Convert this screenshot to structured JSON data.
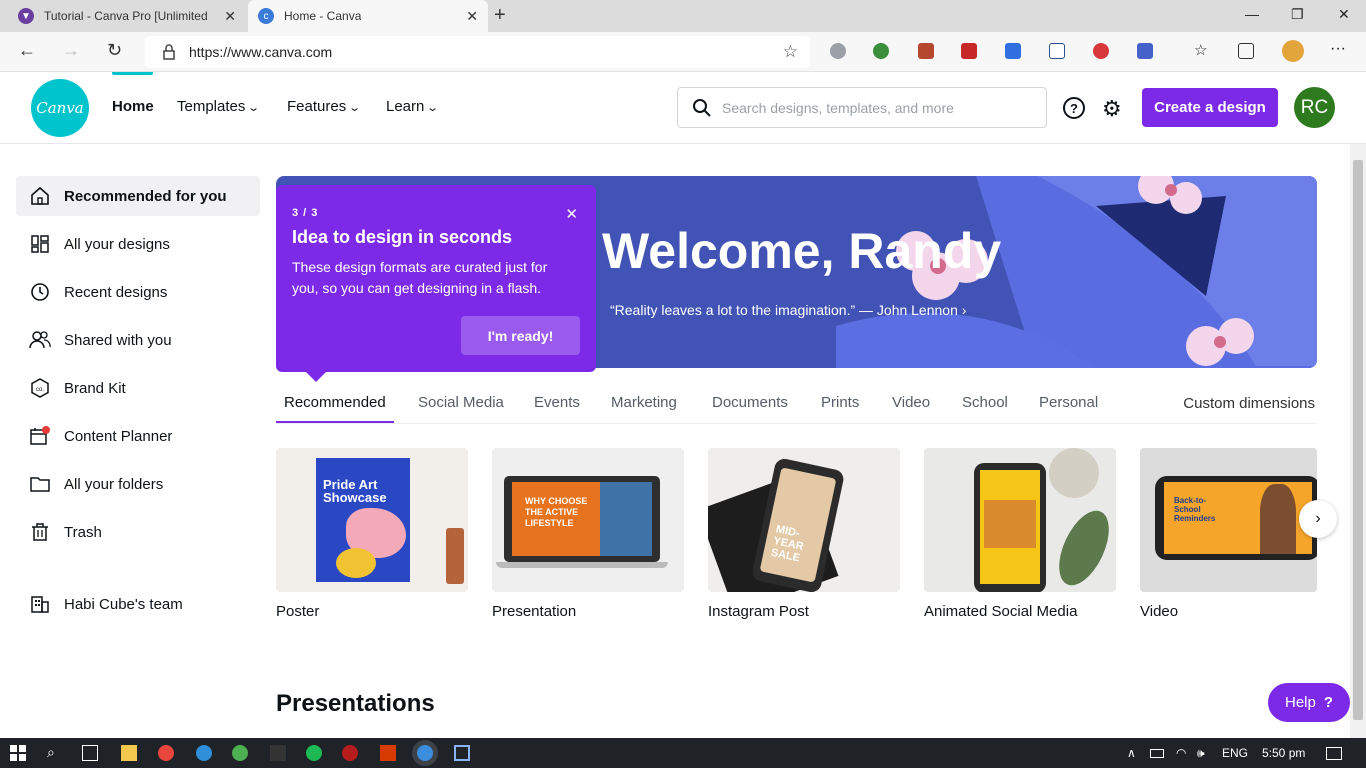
{
  "browser": {
    "tabs": [
      {
        "title": "Tutorial - Canva Pro [Unlimited P"
      },
      {
        "title": "Home - Canva"
      }
    ],
    "url": "https://www.canva.com"
  },
  "header": {
    "logo_text": "Canva",
    "nav": [
      {
        "label": "Home"
      },
      {
        "label": "Templates"
      },
      {
        "label": "Features"
      },
      {
        "label": "Learn"
      }
    ],
    "search_placeholder": "Search designs, templates, and more",
    "create_button": "Create a design",
    "avatar_initials": "RC"
  },
  "sidebar": {
    "items": [
      {
        "label": "Recommended for you"
      },
      {
        "label": "All your designs"
      },
      {
        "label": "Recent designs"
      },
      {
        "label": "Shared with you"
      },
      {
        "label": "Brand Kit"
      },
      {
        "label": "Content Planner"
      },
      {
        "label": "All your folders"
      },
      {
        "label": "Trash"
      },
      {
        "label": "Habi Cube's team"
      }
    ]
  },
  "hero": {
    "title": "Welcome, Randy",
    "quote": "“Reality leaves a lot to the imagination.” — John Lennon ›"
  },
  "tooltip": {
    "step": "3 / 3",
    "title": "Idea to design in seconds",
    "body": "These design formats are curated just for you, so you can get designing in a flash.",
    "button": "I'm ready!"
  },
  "categories": {
    "tabs": [
      {
        "label": "Recommended"
      },
      {
        "label": "Social Media"
      },
      {
        "label": "Events"
      },
      {
        "label": "Marketing"
      },
      {
        "label": "Documents"
      },
      {
        "label": "Prints"
      },
      {
        "label": "Video"
      },
      {
        "label": "School"
      },
      {
        "label": "Personal"
      }
    ],
    "custom": "Custom dimensions"
  },
  "cards": [
    {
      "label": "Poster",
      "thumb_text": "Pride Art Showcase"
    },
    {
      "label": "Presentation",
      "thumb_text": "WHY CHOOSE THE ACTIVE LIFESTYLE"
    },
    {
      "label": "Instagram Post",
      "thumb_text": "MID-YEAR SALE"
    },
    {
      "label": "Animated Social Media",
      "thumb_text": ""
    },
    {
      "label": "Video",
      "thumb_text": "Back-to-School Reminders"
    }
  ],
  "section_title": "Presentations",
  "help_button": "Help",
  "help_symbol": "?",
  "taskbar": {
    "language": "ENG",
    "time": "5:50 pm"
  },
  "colors": {
    "accent": "#7d2ae8",
    "brand": "#00c4cc",
    "hero_bg": "#4153b5"
  }
}
